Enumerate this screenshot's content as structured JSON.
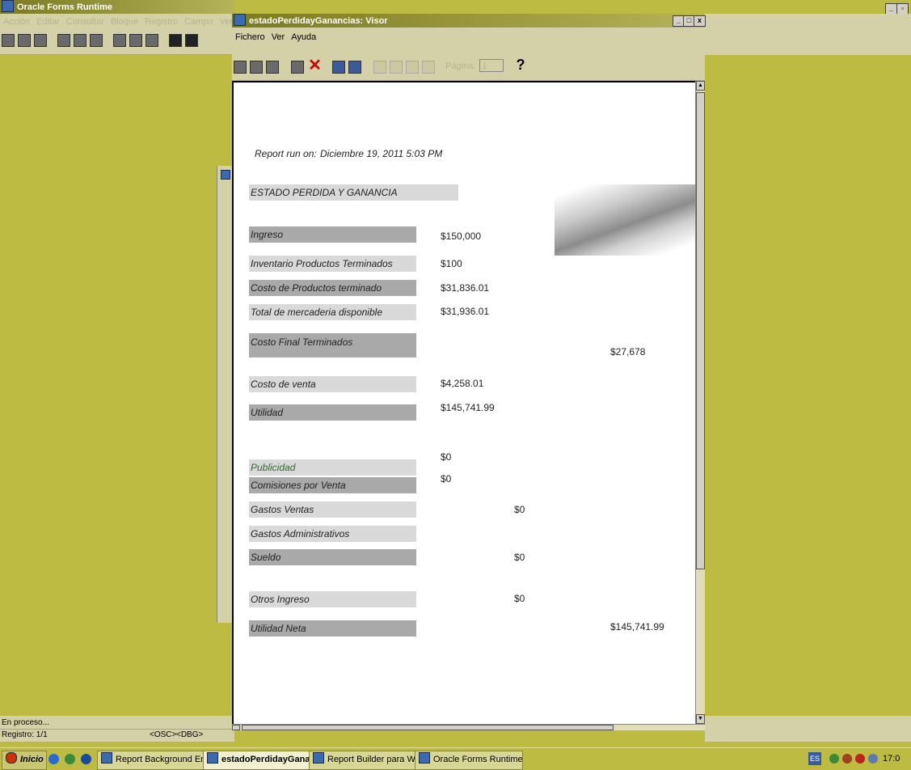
{
  "oracle_forms": {
    "title": "Oracle Forms Runtime",
    "menu": [
      "Acción",
      "Editar",
      "Consultar",
      "Bloque",
      "Registro",
      "Campo",
      "Ventana"
    ],
    "status_line": "En proceso...",
    "record": "Registro: 1/1",
    "osc": "<OSC>",
    "dbg": "<DBG>"
  },
  "viewer": {
    "title": "estadoPerdidayGanancias: Visor",
    "menu": [
      "Fichero",
      "Ver",
      "Ayuda"
    ],
    "page_label": "Página:",
    "page_value": "1",
    "help_glyph": "?"
  },
  "report": {
    "run_on_label": "Report run on:",
    "run_on_value": "Diciembre 19, 2011 5:03 PM",
    "title": "ESTADO PERDIDA Y GANANCIA",
    "rows": [
      {
        "label": "Ingreso",
        "value": "$150,000"
      },
      {
        "label": "Inventario Productos Terminados",
        "value": "$100"
      },
      {
        "label": "Costo de Productos terminado",
        "value": "$31,836.01"
      },
      {
        "label": "Total de mercaderia disponible",
        "value": "$31,936.01"
      },
      {
        "label": "Costo Final Terminados",
        "value": "$27,678"
      },
      {
        "label": "Costo de venta",
        "value": "$4,258.01"
      },
      {
        "label": "Utilidad",
        "value": "$145,741.99"
      },
      {
        "label": "Publicidad",
        "value": "$0"
      },
      {
        "label": "Comisiones por  Venta",
        "value": "$0"
      },
      {
        "label": "Gastos Ventas",
        "value": "$0"
      },
      {
        "label": "Gastos Administrativos",
        "value": ""
      },
      {
        "label": "Sueldo",
        "value": "$0"
      },
      {
        "label": "Otros Ingreso",
        "value": "$0"
      },
      {
        "label": "Utilidad Neta",
        "value": "$145,741.99"
      }
    ]
  },
  "taskbar": {
    "start": "Inicio",
    "items": [
      "Report Background Engine",
      "estadoPerdidayGana...",
      "Report Builder para Wind...",
      "Oracle Forms Runtime"
    ],
    "lang": "ES",
    "clock": "17:0"
  },
  "colors": {
    "desktop": "#bdbb41",
    "label_dark": "#a9a9a9",
    "label_light": "#d9d9d9",
    "publicidad_text": "#2e6b2e"
  }
}
